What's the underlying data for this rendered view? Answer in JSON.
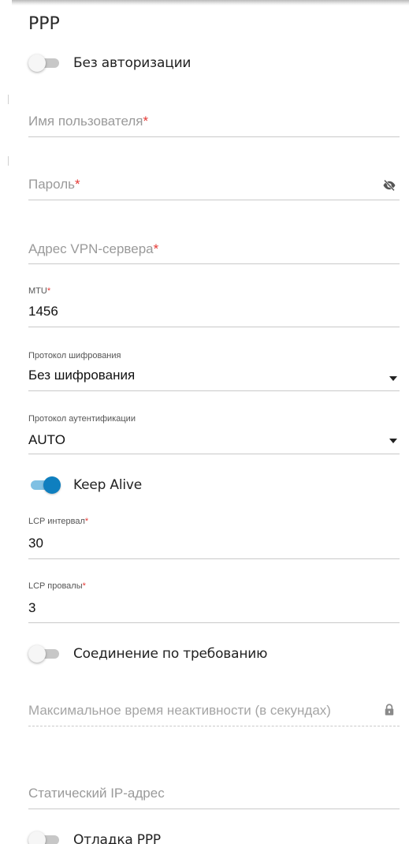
{
  "section": {
    "title": "PPP"
  },
  "toggles": {
    "no_auth": {
      "label": "Без авторизации",
      "on": false
    },
    "keep_alive": {
      "label": "Keep Alive",
      "on": true
    },
    "on_demand": {
      "label": "Соединение по требованию",
      "on": false
    },
    "ppp_debug": {
      "label": "Отладка PPP",
      "on": false
    }
  },
  "fields": {
    "username": {
      "placeholder": "Имя пользователя",
      "required_mark": "*"
    },
    "password": {
      "placeholder": "Пароль",
      "required_mark": "*",
      "icon": "eye-slash-icon"
    },
    "vpn_server": {
      "placeholder": "Адрес VPN-сервера",
      "required_mark": "*"
    },
    "mtu": {
      "label": "MTU",
      "required_mark": "*",
      "value": "1456"
    },
    "encryption": {
      "label": "Протокол шифрования",
      "value": "Без шифрования",
      "icon": "caret-down-icon"
    },
    "auth_protocol": {
      "label": "Протокол аутентификации",
      "value": "AUTO",
      "icon": "caret-down-icon"
    },
    "lcp_interval": {
      "label": "LCP интервал",
      "required_mark": "*",
      "value": "30"
    },
    "lcp_failures": {
      "label": "LCP провалы",
      "required_mark": "*",
      "value": "3"
    },
    "max_idle": {
      "placeholder": "Максимальное время неактивности (в секундах)",
      "icon": "lock-icon"
    },
    "static_ip": {
      "placeholder": "Статический IP-адрес"
    }
  },
  "colors": {
    "accent": "#0f7fbf",
    "accent_track": "#7fc0e3",
    "required": "#e53935",
    "toggle_off_track": "#c7c7c7"
  }
}
